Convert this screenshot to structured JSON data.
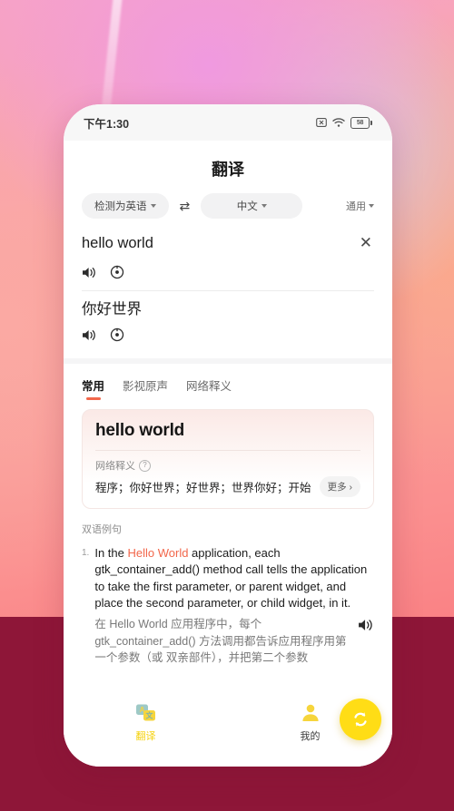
{
  "statusbar": {
    "time": "下午1:30",
    "icons": [
      "x-box-icon",
      "wifi-icon",
      "battery-icon"
    ],
    "battery_level": "58"
  },
  "header": {
    "title": "翻译"
  },
  "language_bar": {
    "source": "检测为英语",
    "swap": "⇄",
    "target": "中文",
    "domain": "通用"
  },
  "translation": {
    "source_text": "hello world",
    "clear_label": "✕",
    "target_text": "你好世界",
    "source_actions": [
      "speaker-icon",
      "slow-speed-icon"
    ],
    "target_actions": [
      "speaker-icon",
      "slow-speed-icon"
    ]
  },
  "tabs": [
    {
      "label": "常用",
      "active": true
    },
    {
      "label": "影视原声",
      "active": false
    },
    {
      "label": "网络释义",
      "active": false
    }
  ],
  "dictionary_card": {
    "word": "hello world",
    "section_label": "网络释义",
    "help_icon": "?",
    "definitions": "程序；你好世界；好世界；世界你好；开始",
    "more_label": "更多 ›"
  },
  "examples": {
    "title": "双语例句",
    "items": [
      {
        "number": "1.",
        "en_prefix": "In the ",
        "en_highlight": "Hello World",
        "en_suffix": " application, each gtk_container_add() method call tells the application to take the first parameter, or parent widget, and place the second parameter, or child widget, in it.",
        "zh": "在 Hello World 应用程序中，每个 gtk_container_add() 方法调用都告诉应用程序用第一个参数（或 双亲部件），并把第二个参数",
        "speaker": "speaker-icon"
      }
    ]
  },
  "fab": {
    "icon": "refresh-swap-icon"
  },
  "bottom_nav": [
    {
      "label": "翻译",
      "icon": "translate-icon",
      "active": true
    },
    {
      "label": "我的",
      "icon": "person-icon",
      "active": false
    }
  ],
  "colors": {
    "accent_orange": "#f2674b",
    "fab_yellow": "#ffdd16",
    "nav_active": "#f5d20e",
    "bottom_band": "#8e1638"
  }
}
